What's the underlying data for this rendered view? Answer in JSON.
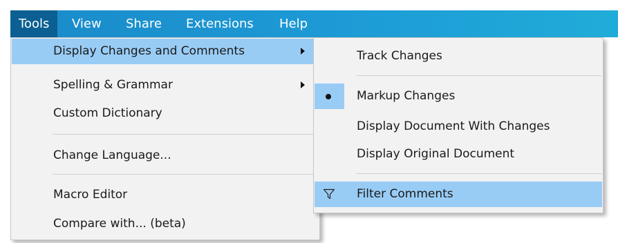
{
  "menubar": {
    "items": [
      {
        "label": "Tools"
      },
      {
        "label": "View"
      },
      {
        "label": "Share"
      },
      {
        "label": "Extensions"
      },
      {
        "label": "Help"
      }
    ]
  },
  "tools_menu": {
    "items": [
      {
        "label": "Display Changes and Comments",
        "has_submenu": true,
        "highlighted": true
      },
      {
        "label": "Spelling & Grammar",
        "has_submenu": true
      },
      {
        "label": "Custom Dictionary"
      },
      {
        "label": "Change Language..."
      },
      {
        "label": "Macro Editor"
      },
      {
        "label": "Compare with... (beta)"
      }
    ]
  },
  "submenu": {
    "items": [
      {
        "label": "Track Changes"
      },
      {
        "label": "Markup Changes",
        "selected": true
      },
      {
        "label": "Display Document With Changes"
      },
      {
        "label": "Display Original Document"
      },
      {
        "label": "Filter Comments",
        "icon": "filter-icon",
        "highlighted": true
      }
    ]
  },
  "colors": {
    "menubar": "#1d9bd6",
    "menubar_active": "#0b5f93",
    "highlight": "#99ccf5",
    "menu_background": "#f2f2f2"
  }
}
